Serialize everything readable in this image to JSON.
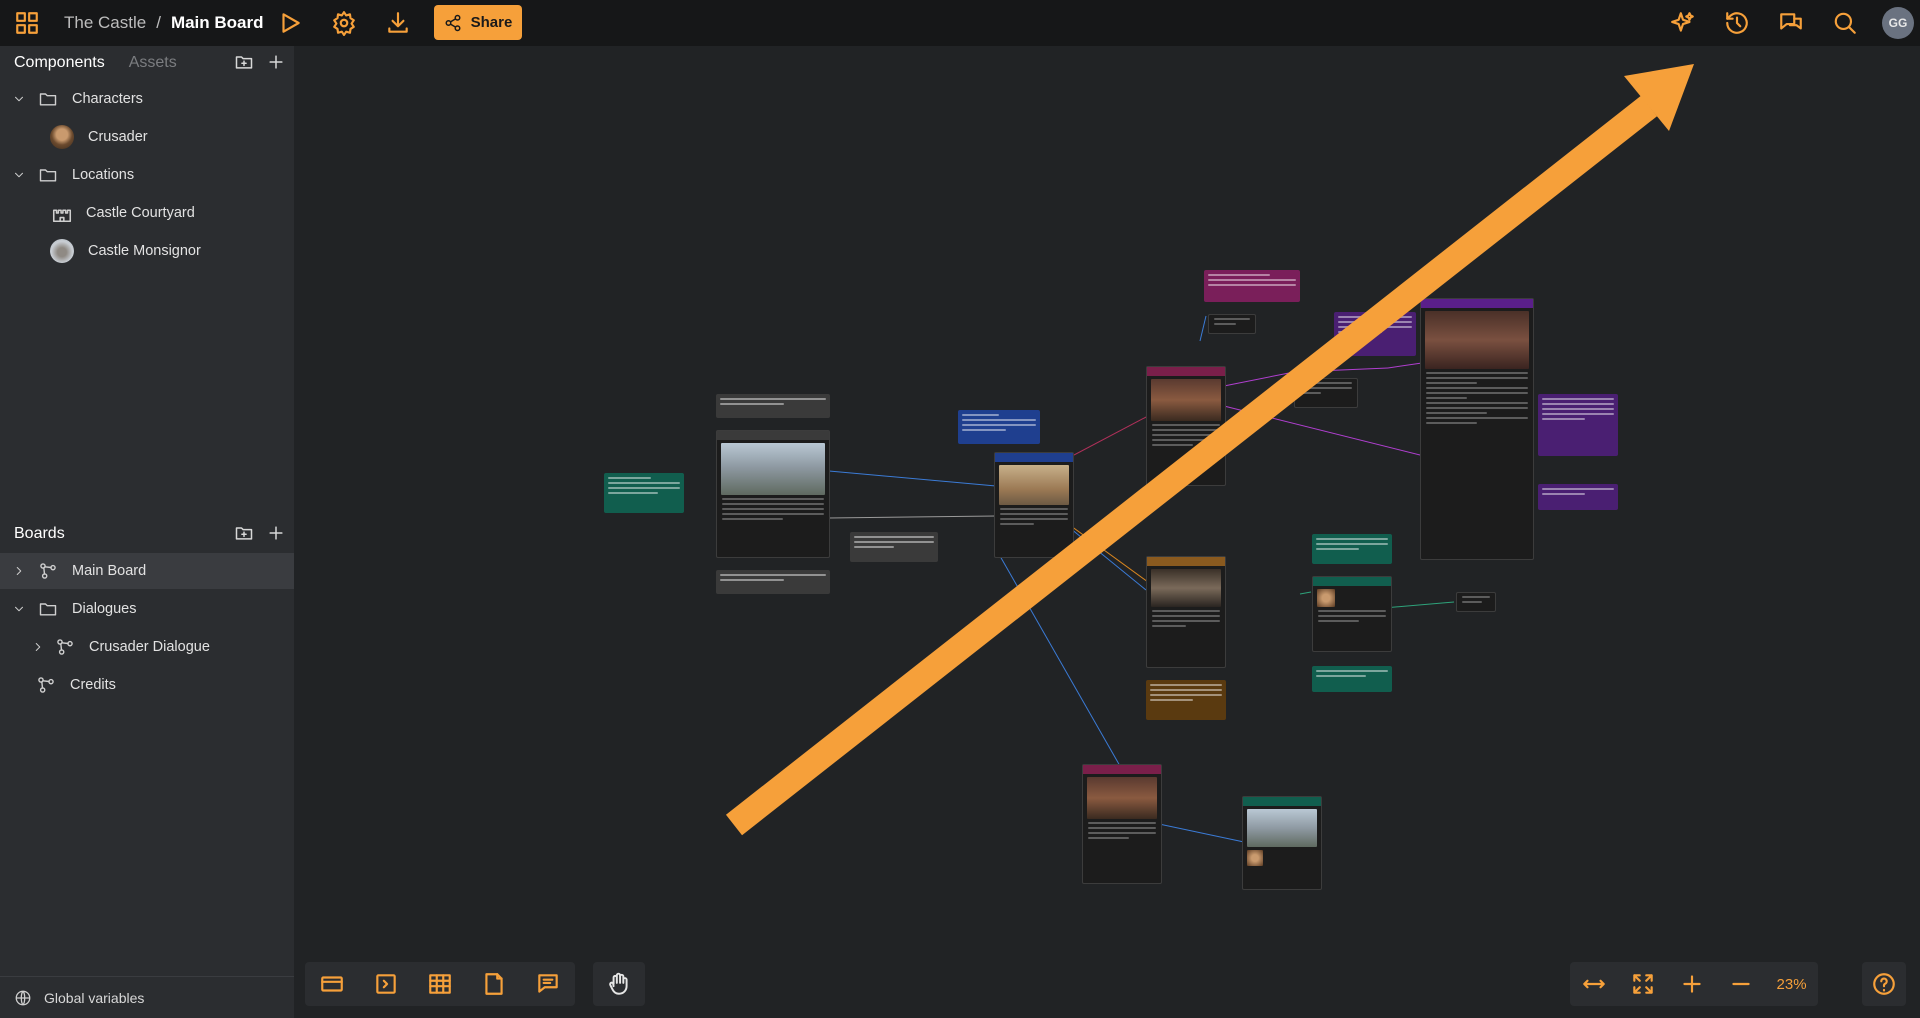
{
  "header": {
    "project": "The Castle",
    "separator": "/",
    "board": "Main Board",
    "share_label": "Share",
    "user_initials": "GG"
  },
  "components_panel": {
    "tab_components": "Components",
    "tab_assets": "Assets",
    "items": [
      {
        "label": "Characters",
        "kind": "folder"
      },
      {
        "label": "Crusader",
        "kind": "character"
      },
      {
        "label": "Locations",
        "kind": "folder"
      },
      {
        "label": "Castle Courtyard",
        "kind": "location"
      },
      {
        "label": "Castle Monsignor",
        "kind": "location"
      }
    ]
  },
  "boards_panel": {
    "title": "Boards",
    "items": [
      {
        "label": "Main Board"
      },
      {
        "label": "Dialogues"
      },
      {
        "label": "Crusader Dialogue"
      },
      {
        "label": "Credits"
      }
    ]
  },
  "footer": {
    "global_variables": "Global variables"
  },
  "canvas": {
    "zoom": "23%",
    "arrow_color": "#f6a03a"
  },
  "colors": {
    "accent": "#f6a03a",
    "topbar": "#161718",
    "sidebar": "#2b2d30",
    "canvas": "#212325"
  }
}
